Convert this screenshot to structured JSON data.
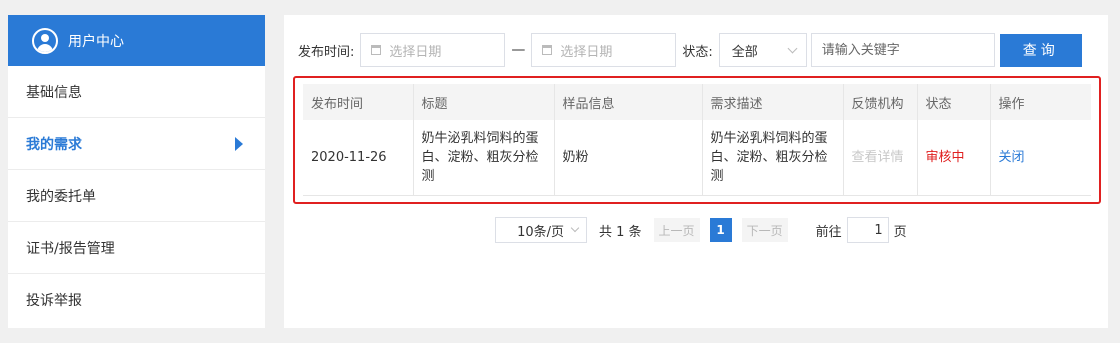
{
  "sidebar": {
    "title": "用户中心",
    "items": [
      {
        "label": "基础信息"
      },
      {
        "label": "我的需求"
      },
      {
        "label": "我的委托单"
      },
      {
        "label": "证书/报告管理"
      },
      {
        "label": "投诉举报"
      }
    ]
  },
  "filters": {
    "publish_time_label": "发布时间:",
    "start_date_placeholder": "选择日期",
    "separator": "—",
    "end_date_placeholder": "选择日期",
    "status_label": "状态:",
    "status_value": "全部",
    "keyword_placeholder": "请输入关键字",
    "search_button": "查询"
  },
  "table": {
    "headers": [
      "发布时间",
      "标题",
      "样品信息",
      "需求描述",
      "反馈机构",
      "状态",
      "操作"
    ],
    "rows": [
      {
        "publish_time": "2020-11-26",
        "title": "奶牛泌乳料饲料的蛋白、淀粉、粗灰分检测",
        "sample": "奶粉",
        "description": "奶牛泌乳料饲料的蛋白、淀粉、粗灰分检测",
        "feedback": "查看详情",
        "status": "审核中",
        "action": "关闭"
      }
    ]
  },
  "pagination": {
    "page_size": "10条/页",
    "total": "共 1 条",
    "prev": "上一页",
    "current": "1",
    "next": "下一页",
    "goto_label": "前往",
    "goto_value": "1",
    "page_suffix": "页"
  },
  "colors": {
    "accent": "#2a7ad6",
    "highlight_frame": "#e02020",
    "status_pending": "#e02020"
  }
}
